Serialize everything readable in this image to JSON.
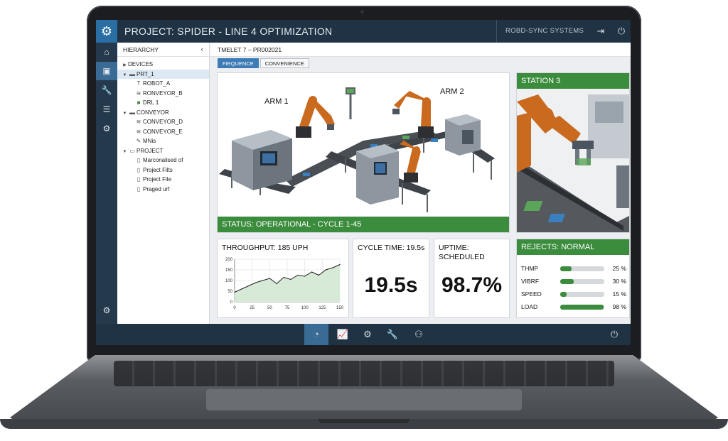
{
  "app": {
    "title": "PROJECT: SPIDER - LINE 4 OPTIMIZATION",
    "brand": "ROBD-SYNC SYSTEMS"
  },
  "titlebar_icons": [
    "gear-icon",
    "export-icon",
    "power-icon"
  ],
  "leftbar": [
    "home-icon",
    "dashboard-icon",
    "wrench-icon",
    "list-icon",
    "settings-icon"
  ],
  "tree": {
    "header": "HIERARCHY",
    "items": [
      {
        "label": "DEVICES",
        "icon": "folder-icon",
        "level": 0
      },
      {
        "label": "PRT_1",
        "icon": "folder-icon",
        "level": 0
      },
      {
        "label": "ROBOT_A",
        "icon": "robot-icon",
        "level": 1
      },
      {
        "label": "RONVEYOR_B",
        "icon": "conveyor-icon",
        "level": 1
      },
      {
        "label": "DRL 1",
        "icon": "drill-icon",
        "level": 1
      },
      {
        "label": "CONVEYOR",
        "icon": "folder-icon",
        "level": 0
      },
      {
        "label": "CONVEYOR_D",
        "icon": "conveyor-icon",
        "level": 1
      },
      {
        "label": "CONVEYOR_E",
        "icon": "conveyor-icon",
        "level": 1
      },
      {
        "label": "MNis",
        "icon": "tool-icon",
        "level": 1
      },
      {
        "label": "PROJECT",
        "icon": "folder-icon",
        "level": 0
      },
      {
        "label": "Marconalised of",
        "icon": "file-icon",
        "level": 1
      },
      {
        "label": "Project Filts",
        "icon": "file-icon",
        "level": 1
      },
      {
        "label": "Project File",
        "icon": "file-icon",
        "level": 1
      },
      {
        "label": "Praged urf",
        "icon": "file-icon",
        "level": 1
      }
    ]
  },
  "breadcrumb": "TMELET 7 – PR002021",
  "tabs": [
    {
      "label": "FIEQUENCE",
      "active": true
    },
    {
      "label": "CONVENIENCE",
      "active": false
    }
  ],
  "factory": {
    "arm1": "ARM 1",
    "arm2": "ARM 2",
    "status": "STATUS: OPERATIONAL - CYCLE 1-45"
  },
  "station": {
    "title": "STATION 3"
  },
  "throughput": {
    "title": "THROUGHPUT: 185 UPH"
  },
  "cycle_time": {
    "title": "CYCLE TIME: 19.5s",
    "value": "19.5s"
  },
  "uptime": {
    "title_line1": "UPTIME:",
    "title_line2": "SCHEDULED",
    "value": "98.7%"
  },
  "rejects": {
    "title": "REJECTS: NORMAL",
    "rows": [
      {
        "name": "THMP",
        "value": "25 %",
        "pct": 25
      },
      {
        "name": "VIBRF",
        "value": "30 %",
        "pct": 30
      },
      {
        "name": "SPEED",
        "value": "15 %",
        "pct": 15
      },
      {
        "name": "LOAD",
        "value": "98 %",
        "pct": 98
      }
    ]
  },
  "bottombar": [
    "gauge-icon",
    "chart-icon",
    "gear-icon",
    "wrench-icon",
    "team-icon",
    "power-icon"
  ],
  "chart_data": {
    "type": "line",
    "x": [
      0,
      10,
      20,
      30,
      40,
      50,
      60,
      70,
      80,
      90,
      100,
      110,
      120,
      130,
      140,
      150
    ],
    "y": [
      45,
      60,
      75,
      90,
      100,
      110,
      85,
      115,
      105,
      125,
      120,
      140,
      125,
      150,
      160,
      175
    ],
    "xticks": [
      "0",
      "25",
      "50",
      "75",
      "100",
      "125",
      "150"
    ],
    "yticks": [
      "0",
      "50",
      "100",
      "150",
      "200"
    ],
    "xlim": [
      0,
      150
    ],
    "ylim": [
      0,
      200
    ],
    "grid": true,
    "colors": {
      "line": "#1f1f1f",
      "fill": "#d7ead7"
    }
  }
}
